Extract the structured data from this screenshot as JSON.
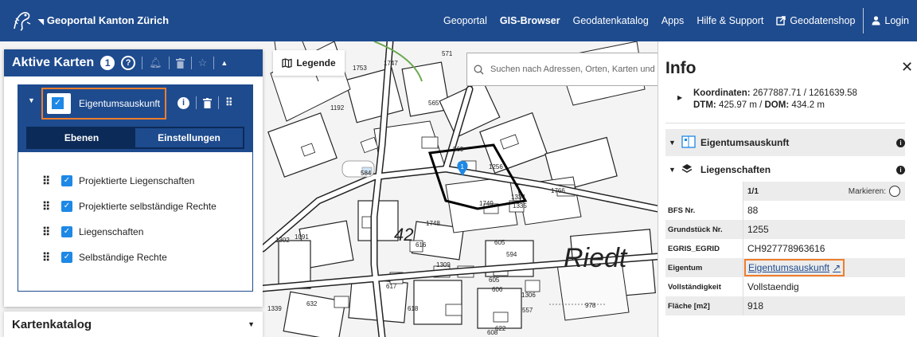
{
  "header": {
    "brand": "Geoportal Kanton Zürich",
    "nav": [
      "Geoportal",
      "GIS-Browser",
      "Geodatenkatalog",
      "Apps",
      "Hilfe & Support"
    ],
    "active_nav": "GIS-Browser",
    "shop": "Geodatenshop",
    "login": "Login"
  },
  "active_maps": {
    "title": "Aktive Karten",
    "count": "1",
    "map_layer": "Eigentumsauskunft",
    "tabs": [
      "Ebenen",
      "Einstellungen"
    ],
    "layers": [
      "Projektierte Liegenschaften",
      "Projektierte selbständige Rechte",
      "Liegenschaften",
      "Selbständige Rechte"
    ]
  },
  "catalog": {
    "title": "Kartenkatalog"
  },
  "legend": {
    "label": "Legende"
  },
  "search": {
    "placeholder": "Suchen nach Adressen, Orten, Karten und mehr"
  },
  "map": {
    "place_label": "Riedt",
    "parcel_numbers": [
      "1753",
      "1747",
      "1192",
      "565",
      "571",
      "584",
      "569",
      "1256",
      "1766",
      "1749",
      "1334",
      "1335",
      "1091",
      "1302",
      "1748",
      "605",
      "594",
      "616",
      "617",
      "1309",
      "605",
      "606",
      "1306",
      "632",
      "618",
      "557",
      "622",
      "608",
      "978",
      "1339"
    ],
    "marker": "1"
  },
  "info": {
    "title": "Info",
    "coords_label": "Koordinaten:",
    "coords_value": "2677887.71 / 1261639.58",
    "dtm_label": "DTM:",
    "dtm_value": "425.97 m",
    "dom_label": "DOM:",
    "dom_value": "434.2 m",
    "section_map": "Eigentumsauskunft",
    "section_layer": "Liegenschaften",
    "pager": "1/1",
    "mark_label": "Markieren:",
    "rows": [
      {
        "k": "BFS Nr.",
        "v": "88"
      },
      {
        "k": "Grundstück Nr.",
        "v": "1255"
      },
      {
        "k": "EGRIS_EGRID",
        "v": "CH927778963616"
      },
      {
        "k": "Eigentum",
        "v": "Eigentumsauskunft"
      },
      {
        "k": "Vollständigkeit",
        "v": "Vollstaendig"
      },
      {
        "k": "Fläche [m2]",
        "v": "918"
      }
    ]
  },
  "colors": {
    "primary": "#1e4b8e",
    "accent": "#ef7d2c",
    "checkbox": "#1e88e5"
  }
}
